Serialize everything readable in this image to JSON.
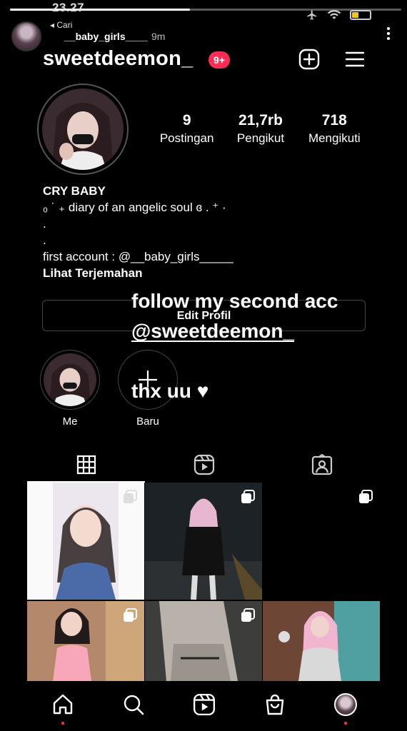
{
  "status_bar": {
    "time": "23.27"
  },
  "story_header": {
    "back_label": "Cari",
    "username": "__baby_girls____",
    "time_ago": "9m"
  },
  "profile": {
    "username": "sweetdeemon_",
    "notification_badge": "9+",
    "stats": [
      {
        "value": "9",
        "label": "Postingan"
      },
      {
        "value": "21,7rb",
        "label": "Pengikut"
      },
      {
        "value": "718",
        "label": "Mengikuti"
      }
    ],
    "bio": {
      "name": "CRY BABY",
      "lines": [
        "₀ ˙ ₊ diary of an angelic soul ɞ . ⁺  ·",
        ".",
        ".",
        "first account : @__baby_girls_____"
      ],
      "translate_link": "Lihat Terjemahan"
    },
    "edit_button": "Edit Profil"
  },
  "overlay": {
    "line1": "follow my second acc",
    "line2": "@sweetdeemon_",
    "line3": "thx uu ♥"
  },
  "highlights": [
    {
      "label": "Me"
    },
    {
      "label": "Baru"
    }
  ],
  "tabs": [
    "grid-icon",
    "reels-icon",
    "tagged-icon"
  ],
  "bottom_nav": [
    "home-icon",
    "search-icon",
    "reels-icon",
    "shop-icon",
    "profile-avatar"
  ]
}
